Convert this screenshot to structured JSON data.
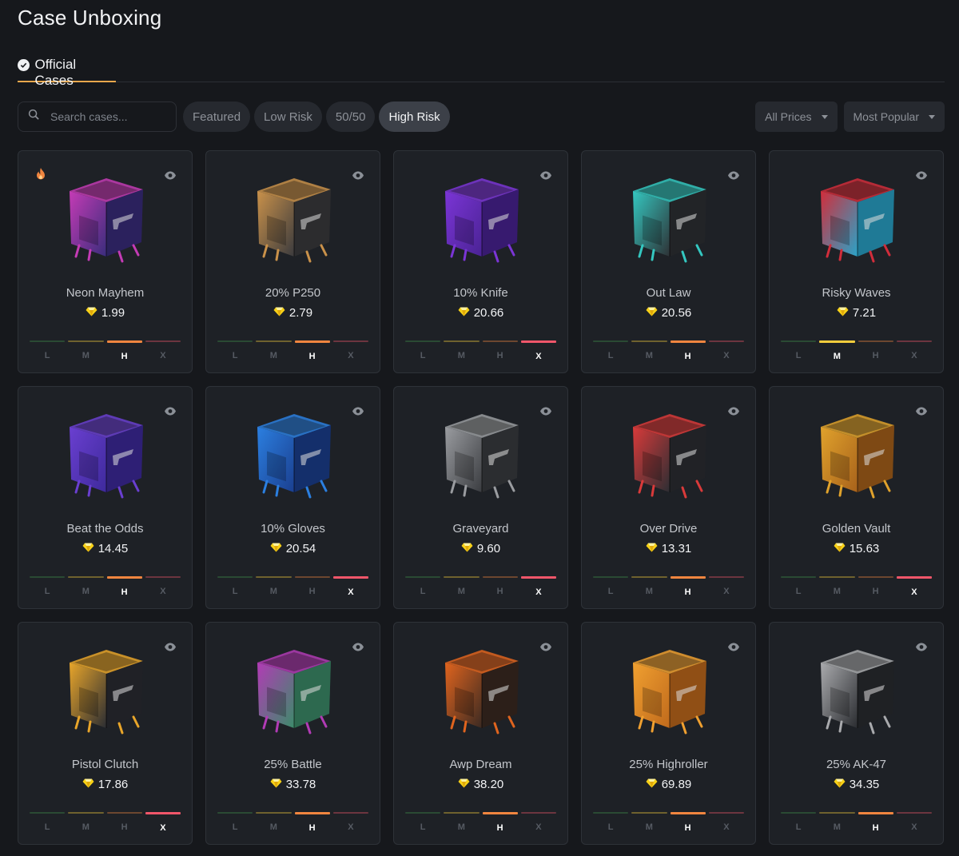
{
  "page_title": "Case Unboxing",
  "tab": {
    "label": "Official Cases"
  },
  "search": {
    "placeholder": "Search cases..."
  },
  "filters": [
    {
      "label": "Featured",
      "active": false
    },
    {
      "label": "Low Risk",
      "active": false
    },
    {
      "label": "50/50",
      "active": false
    },
    {
      "label": "High Risk",
      "active": true
    }
  ],
  "dropdowns": {
    "price": "All Prices",
    "sort": "Most Popular"
  },
  "risk_levels": [
    "L",
    "M",
    "H",
    "X"
  ],
  "colors": {
    "accent": "#e9a84c",
    "risk_l": "#3f8e4a",
    "risk_m": "#f4cd3c",
    "risk_h": "#f0853f",
    "risk_x": "#f0566a",
    "diamond": "#f7d117"
  },
  "cases": [
    {
      "name": "Neon Mayhem",
      "price": "1.99",
      "risk": "H",
      "hot": true,
      "icon": "case-box-icon",
      "colors": [
        "#c43bb5",
        "#3a2d7c"
      ]
    },
    {
      "name": "20% P250",
      "price": "2.79",
      "risk": "H",
      "hot": false,
      "icon": "case-box-icon",
      "colors": [
        "#c9914a",
        "#3b3b3e"
      ]
    },
    {
      "name": "10% Knife",
      "price": "20.66",
      "risk": "X",
      "hot": false,
      "icon": "case-box-icon",
      "colors": [
        "#7b35d6",
        "#4a2394"
      ]
    },
    {
      "name": "Out Law",
      "price": "20.56",
      "risk": "H",
      "hot": false,
      "icon": "case-box-icon",
      "colors": [
        "#34c7c0",
        "#2e3135"
      ]
    },
    {
      "name": "Risky Waves",
      "price": "7.21",
      "risk": "M",
      "hot": false,
      "icon": "case-box-icon",
      "colors": [
        "#d12d3b",
        "#2aa3c8"
      ]
    },
    {
      "name": "Beat the Odds",
      "price": "14.45",
      "risk": "H",
      "hot": false,
      "icon": "case-box-icon",
      "colors": [
        "#6a3fd0",
        "#3e2a9c"
      ]
    },
    {
      "name": "10% Gloves",
      "price": "20.54",
      "risk": "X",
      "hot": false,
      "icon": "case-box-icon",
      "colors": [
        "#2b7fe0",
        "#1b3f8f"
      ]
    },
    {
      "name": "Graveyard",
      "price": "9.60",
      "risk": "X",
      "hot": false,
      "icon": "case-box-icon",
      "colors": [
        "#9a9ca0",
        "#3a3c40"
      ]
    },
    {
      "name": "Over Drive",
      "price": "13.31",
      "risk": "H",
      "hot": false,
      "icon": "case-box-icon",
      "colors": [
        "#d93a3a",
        "#2c2e33"
      ]
    },
    {
      "name": "Golden Vault",
      "price": "15.63",
      "risk": "X",
      "hot": false,
      "icon": "case-box-icon",
      "colors": [
        "#e0a22c",
        "#a8621b"
      ]
    },
    {
      "name": "Pistol Clutch",
      "price": "17.86",
      "risk": "X",
      "hot": false,
      "icon": "case-box-icon",
      "colors": [
        "#e8a52a",
        "#2b2d33"
      ]
    },
    {
      "name": "25% Battle",
      "price": "33.78",
      "risk": "H",
      "hot": false,
      "icon": "case-box-icon",
      "colors": [
        "#b13bb5",
        "#3c8c6a"
      ]
    },
    {
      "name": "Awp Dream",
      "price": "38.20",
      "risk": "H",
      "hot": false,
      "icon": "case-box-icon",
      "colors": [
        "#e0641e",
        "#3b2a22"
      ]
    },
    {
      "name": "25% Highroller",
      "price": "69.89",
      "risk": "H",
      "hot": false,
      "icon": "case-box-icon",
      "colors": [
        "#f0a030",
        "#c06a1c"
      ]
    },
    {
      "name": "25% AK-47",
      "price": "34.35",
      "risk": "H",
      "hot": false,
      "icon": "case-box-icon",
      "colors": [
        "#a9aaad",
        "#2a2c30"
      ]
    }
  ]
}
